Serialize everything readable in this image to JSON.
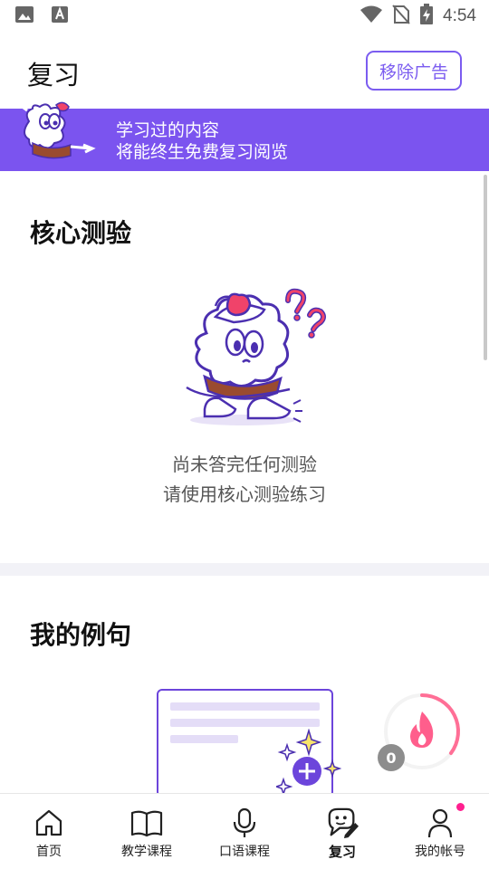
{
  "status_bar": {
    "time": "4:54"
  },
  "header": {
    "title": "复习",
    "remove_ads_label": "移除广告"
  },
  "banner": {
    "line1": "学习过的内容",
    "line2": "将能终生免费复习阅览"
  },
  "core_quiz": {
    "title": "核心测验",
    "empty_line1": "尚未答完任何测验",
    "empty_line2": "请使用核心测验练习"
  },
  "my_examples": {
    "title": "我的例句"
  },
  "streak": {
    "count": "0"
  },
  "nav": {
    "items": [
      {
        "label": "首页",
        "icon": "home-icon"
      },
      {
        "label": "教学课程",
        "icon": "book-icon"
      },
      {
        "label": "口语课程",
        "icon": "microphone-icon"
      },
      {
        "label": "复习",
        "icon": "review-icon"
      },
      {
        "label": "我的帐号",
        "icon": "account-icon"
      }
    ]
  },
  "colors": {
    "accent": "#7b54ef",
    "pink": "#ff1f8f",
    "card_border": "#6c45db"
  }
}
